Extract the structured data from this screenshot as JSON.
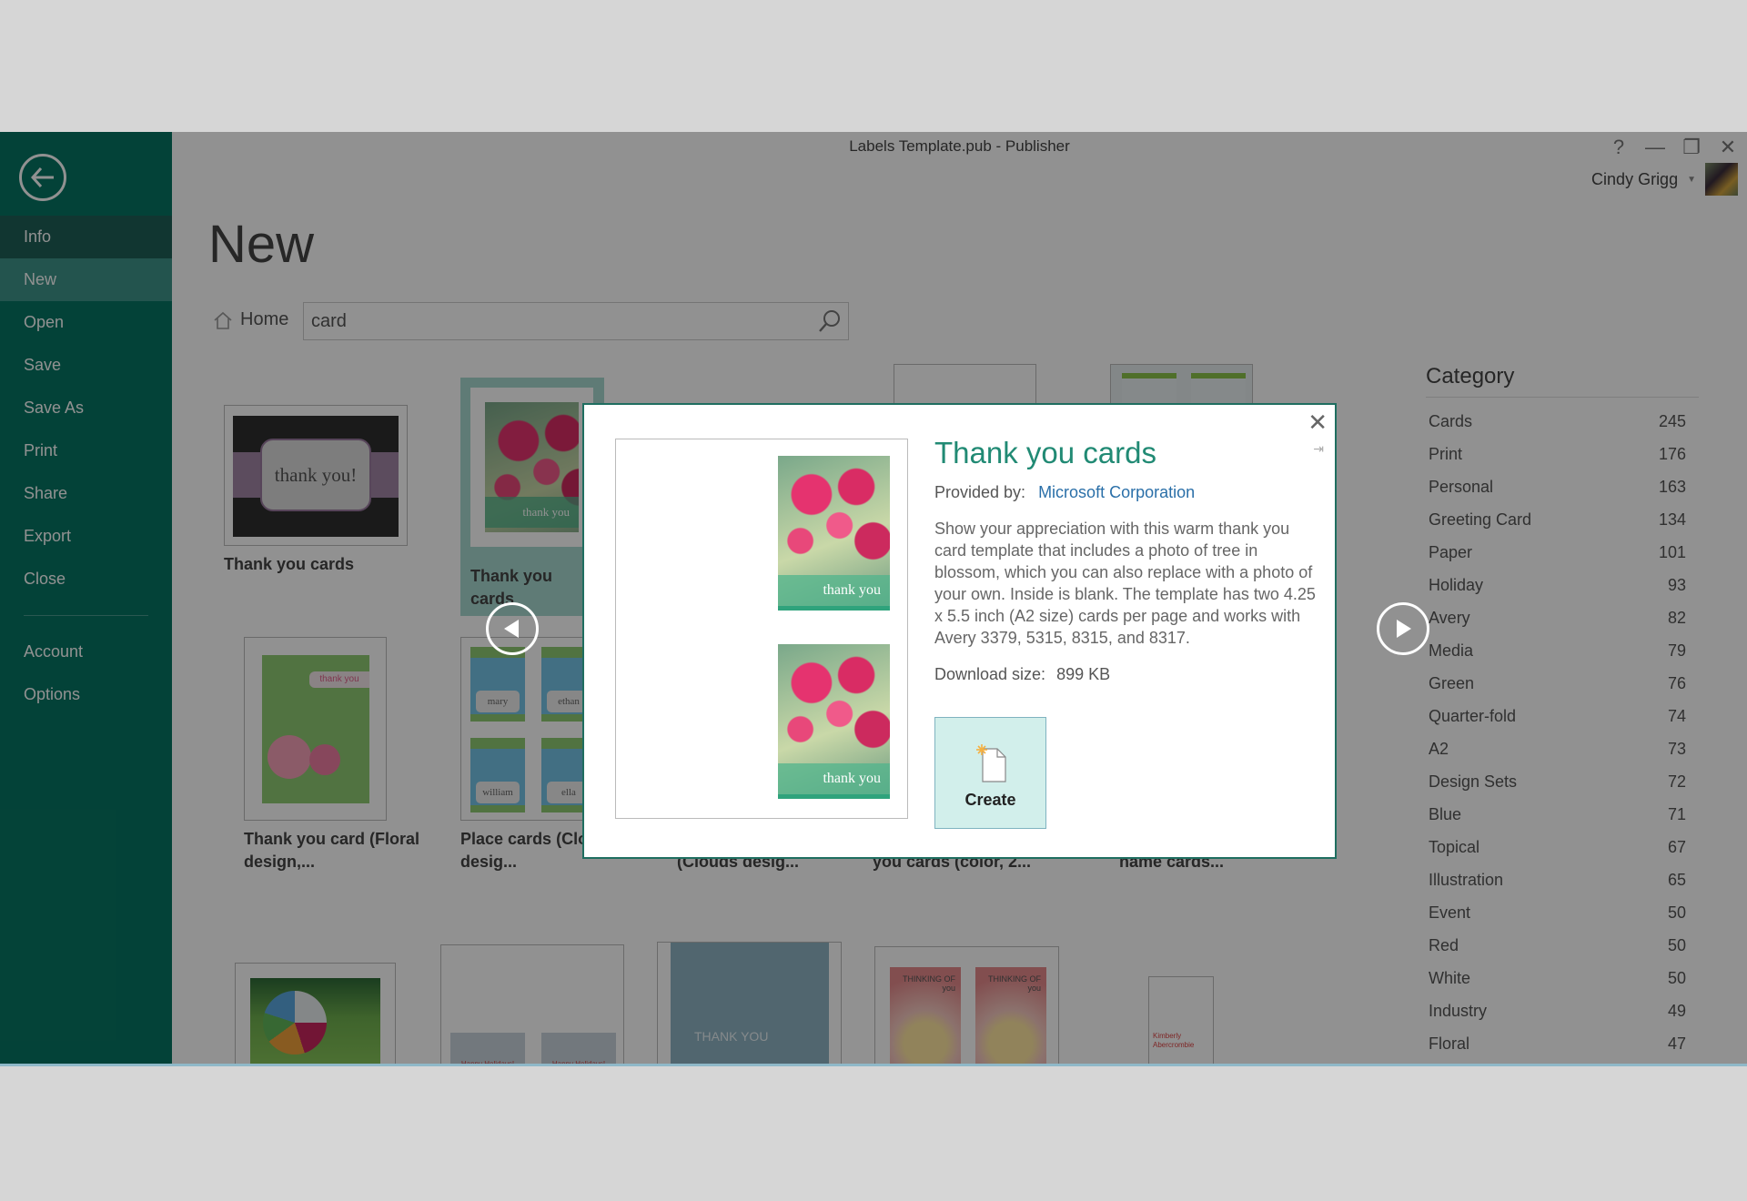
{
  "window": {
    "title": "Labels Template.pub - Publisher",
    "controls": {
      "help": "?",
      "minimize": "—",
      "restore": "❐",
      "close": "✕"
    },
    "user_name": "Cindy Grigg"
  },
  "sidebar": {
    "items": [
      {
        "label": "Info"
      },
      {
        "label": "New"
      },
      {
        "label": "Open"
      },
      {
        "label": "Save"
      },
      {
        "label": "Save As"
      },
      {
        "label": "Print"
      },
      {
        "label": "Share"
      },
      {
        "label": "Export"
      },
      {
        "label": "Close"
      },
      {
        "label": "Account"
      },
      {
        "label": "Options"
      }
    ],
    "active": "New"
  },
  "main": {
    "page_title": "New",
    "breadcrumb_home": "Home",
    "search_value": "card",
    "templates": [
      {
        "caption": "Thank you cards",
        "thumb_text": "thank you!"
      },
      {
        "caption": "Thank you cards",
        "thumb_text": "thank you",
        "selected": true
      },
      {
        "caption": "Thank you card (Floral design,...",
        "thumb_text": "thank you"
      },
      {
        "caption": "Place cards (Clouds desig...",
        "names": [
          "mary",
          "ethan",
          "william",
          "ella"
        ]
      },
      {
        "caption": "(Clouds desig..."
      },
      {
        "caption": "you cards (color, 2..."
      },
      {
        "caption": "name cards..."
      }
    ],
    "bottom_row_texts": [
      "Happy Holidays!",
      "Happy Holidays!",
      "THANK YOU",
      "THINKING OF you",
      "Kimberly Abercrombie"
    ]
  },
  "category": {
    "title": "Category",
    "items": [
      {
        "label": "Cards",
        "count": "245"
      },
      {
        "label": "Print",
        "count": "176"
      },
      {
        "label": "Personal",
        "count": "163"
      },
      {
        "label": "Greeting Card",
        "count": "134"
      },
      {
        "label": "Paper",
        "count": "101"
      },
      {
        "label": "Holiday",
        "count": "93"
      },
      {
        "label": "Avery",
        "count": "82"
      },
      {
        "label": "Media",
        "count": "79"
      },
      {
        "label": "Green",
        "count": "76"
      },
      {
        "label": "Quarter-fold",
        "count": "74"
      },
      {
        "label": "A2",
        "count": "73"
      },
      {
        "label": "Design Sets",
        "count": "72"
      },
      {
        "label": "Blue",
        "count": "71"
      },
      {
        "label": "Topical",
        "count": "67"
      },
      {
        "label": "Illustration",
        "count": "65"
      },
      {
        "label": "Event",
        "count": "50"
      },
      {
        "label": "Red",
        "count": "50"
      },
      {
        "label": "White",
        "count": "50"
      },
      {
        "label": "Industry",
        "count": "49"
      },
      {
        "label": "Floral",
        "count": "47"
      }
    ]
  },
  "dialog": {
    "title": "Thank you cards",
    "provided_by_label": "Provided by:",
    "provider": "Microsoft Corporation",
    "description": "Show your appreciation with this warm thank you card template that includes a photo of tree in blossom, which you can also replace with a photo of your own. Inside is blank. The template has two 4.25 x 5.5 inch (A2 size) cards per page and works with Avery 3379, 5315, 8315, and 8317.",
    "download_size_label": "Download size:",
    "download_size": "899 KB",
    "create_label": "Create",
    "preview_card_text": "thank you",
    "close": "✕",
    "pin": "⇥"
  },
  "colors": {
    "brand": "#077563",
    "accent_title": "#218a74",
    "link": "#2a6fa8"
  }
}
